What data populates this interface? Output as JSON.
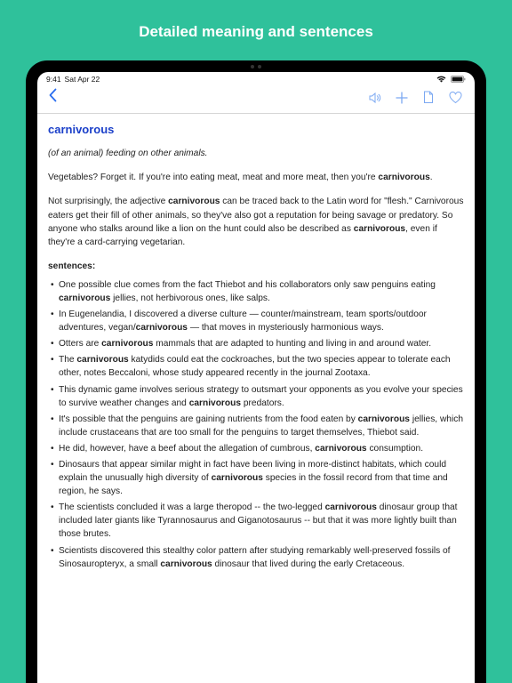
{
  "promo": {
    "title": "Detailed meaning and sentences"
  },
  "status": {
    "time": "9:41",
    "date": "Sat Apr 22"
  },
  "nav": {
    "icons": {
      "back": "chevron-left",
      "speaker": "speaker",
      "plus": "plus",
      "doc": "document",
      "heart": "heart"
    }
  },
  "entry": {
    "word": "carnivorous",
    "definition": "(of an animal) feeding on other animals.",
    "para1_html": "Vegetables? Forget it. If you're into eating meat, meat and more meat, then you're <b>carnivorous</b>.",
    "para2_html": "Not surprisingly, the adjective <b>carnivorous</b> can be traced back to the Latin word for \"flesh.\" Carnivorous eaters get their fill of other animals, so they've also got a reputation for being savage or predatory. So anyone who stalks around like a lion on the hunt could also be described as <b>carnivorous</b>, even if they're a card-carrying vegetarian.",
    "sentences_label": "sentences:",
    "sentences_html": [
      "One possible clue comes from the fact Thiebot and his collaborators only saw penguins eating <b>carnivorous</b> jellies, not herbivorous ones, like salps.",
      "In Eugenelandia, I discovered a diverse culture — counter/mainstream, team sports/outdoor adventures, vegan/<b>carnivorous</b> — that moves in mysteriously harmonious ways.",
      "Otters are <b>carnivorous</b> mammals that are adapted to hunting and living in and around water.",
      "The <b>carnivorous</b> katydids could eat the cockroaches, but the two species appear to tolerate each other, notes Beccaloni, whose study appeared recently in the journal Zootaxa.",
      "This dynamic game involves serious strategy to outsmart your opponents as you evolve your species to survive weather changes and <b>carnivorous</b> predators.",
      "It's possible that the penguins are gaining nutrients from the food eaten by <b>carnivorous</b> jellies, which include crustaceans that are too small for the penguins to target themselves, Thiebot said.",
      "He did, however, have a beef about the allegation of cumbrous, <b>carnivorous</b> consumption.",
      "Dinosaurs that appear similar might in fact have been living in more-distinct habitats, which could explain the unusually high diversity of <b>carnivorous</b> species in the fossil record from that time and region, he says.",
      "The scientists concluded it was a large theropod -- the two-legged <b>carnivorous</b> dinosaur group that included later giants like Tyrannosaurus and Giganotosaurus -- but that it was more lightly built than those brutes.",
      "Scientists discovered this stealthy color pattern after studying remarkably well-preserved fossils of Sinosauropteryx, a small <b>carnivorous</b> dinosaur that lived during the early Cretaceous."
    ]
  }
}
